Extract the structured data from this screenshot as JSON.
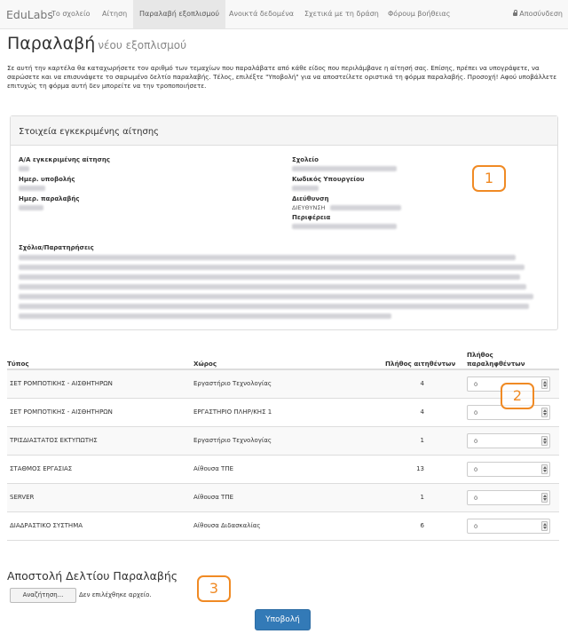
{
  "navbar": {
    "brand": "EduLabs",
    "items": [
      "Το σχολείο",
      "Αίτηση",
      "Παραλαβή εξοπλισμού",
      "Ανοικτά δεδομένα",
      "Σχετικά με τη δράση",
      "Φόρουμ βοήθειας"
    ],
    "active_index": 2,
    "logout_label": "Αποσύνδεση"
  },
  "page": {
    "title": "Παραλαβή",
    "subtitle": "νέου εξοπλισμού",
    "intro": "Σε αυτή την καρτέλα θα καταχωρήσετε τον αριθμό των τεμαχίων που παραλάβατε από κάθε είδος που περιλάμβανε η αίτησή σας. Επίσης, πρέπει να υπογράψετε, να σαρώσετε και να επισυνάψετε το σαρωμένο δελτίο παραλαβής. Τέλος, επιλέξτε \"Υποβολή\" για να αποστείλετε οριστικά τη φόρμα παραλαβής. Προσοχή! Αφού υποβάλλετε επιτυχώς τη φόρμα αυτή δεν μπορείτε να την τροποποιήσετε."
  },
  "panel": {
    "title": "Στοιχεία εγκεκριμένης αίτησης",
    "labels": {
      "aa": "Α/Α εγκεκριμένης αίτησης",
      "submit_date": "Ημερ. υποβολής",
      "receive_date": "Ημερ. παραλαβής",
      "school": "Σχολείο",
      "ministry_code": "Κωδικός Υπουργείου",
      "address": "Διεύθυνση",
      "address_value_prefix": "ΔΙΕΥΘΥΝΣΗ",
      "region": "Περιφέρεια",
      "comments": "Σχόλια/Παρατηρήσεις"
    }
  },
  "callouts": [
    "1",
    "2",
    "3"
  ],
  "table": {
    "headers": {
      "type": "Τύπος",
      "space": "Χώρος",
      "requested": "Πλήθος αιτηθέντων",
      "received_line1": "Πλήθος",
      "received_line2": "παραληφθέντων"
    },
    "rows": [
      {
        "type": "ΣΕΤ ΡΟΜΠΟΤΙΚΗΣ - ΑΙΣΘΗΤΗΡΩΝ",
        "space": "Εργαστήριο Τεχνολογίας",
        "requested": "4",
        "received": "0"
      },
      {
        "type": "ΣΕΤ ΡΟΜΠΟΤΙΚΗΣ - ΑΙΣΘΗΤΗΡΩΝ",
        "space": "ΕΡΓΑΣΤΗΡΙΟ ΠΛΗΡ/ΚΗΣ 1",
        "requested": "4",
        "received": "0"
      },
      {
        "type": "ΤΡΙΣΔΙΑΣΤΑΤΟΣ ΕΚΤΥΠΩΤΗΣ",
        "space": "Εργαστήριο Τεχνολογίας",
        "requested": "1",
        "received": "0"
      },
      {
        "type": "ΣΤΑΘΜΟΣ ΕΡΓΑΣΙΑΣ",
        "space": "Αίθουσα ΤΠΕ",
        "requested": "13",
        "received": "0"
      },
      {
        "type": "SERVER",
        "space": "Αίθουσα ΤΠΕ",
        "requested": "1",
        "received": "0"
      },
      {
        "type": "ΔΙΑΔΡΑΣΤΙΚΟ ΣΥΣΤΗΜΑ",
        "space": "Αίθουσα Διδασκαλίας",
        "requested": "6",
        "received": "0"
      }
    ]
  },
  "upload": {
    "title": "Αποστολή Δελτίου Παραλαβής",
    "browse_label": "Αναζήτηση...",
    "no_file": "Δεν επιλέχθηκε αρχείο."
  },
  "submit_label": "Υποβολή",
  "colors": {
    "accent": "#337ab7",
    "callout": "#f08a24"
  }
}
